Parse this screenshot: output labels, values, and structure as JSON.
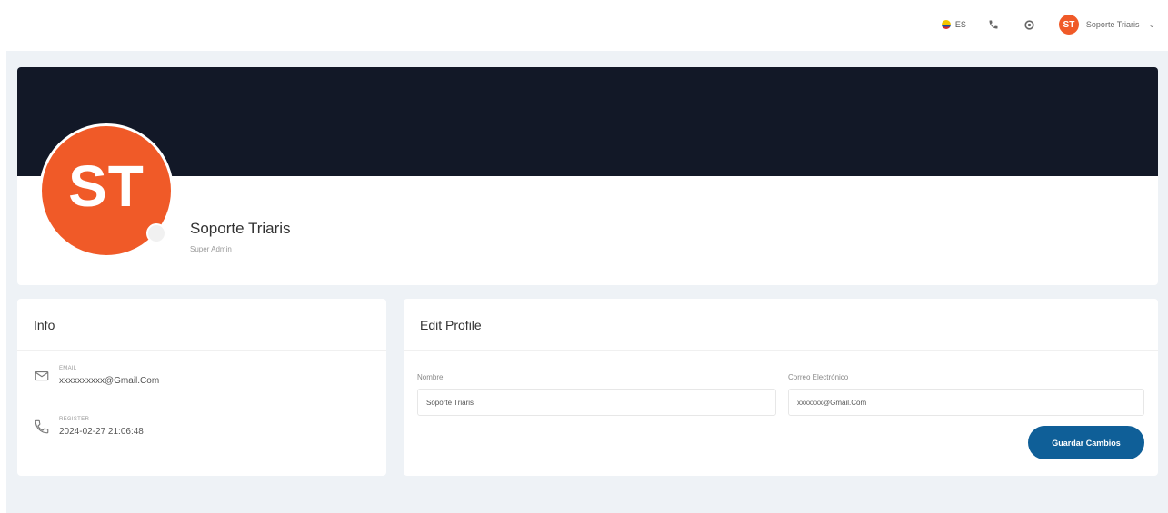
{
  "topbar": {
    "language": "ES",
    "user_initials": "ST",
    "user_name": "Soporte Triaris"
  },
  "profile": {
    "initials": "ST",
    "name": "Soporte Triaris",
    "role": "Super Admin"
  },
  "info": {
    "title": "Info",
    "email_label": "EMAIL",
    "email_value": "xxxxxxxxxx@Gmail.Com",
    "register_label": "REGISTER",
    "register_value": "2024-02-27 21:06:48"
  },
  "edit_profile": {
    "title": "Edit Profile",
    "name_label": "Nombre",
    "name_value": "Soporte Triaris",
    "email_label": "Correo Electrónico",
    "email_value": "xxxxxxx@Gmail.Com",
    "save_label": "Guardar Cambios"
  },
  "colors": {
    "banner": "#121827",
    "avatar": "#f05a28",
    "primary_button": "#0f5f98",
    "page_background": "#eef2f6"
  },
  "icons": [
    "flag-icon",
    "phone-icon",
    "settings-icon",
    "chevron-down-icon",
    "mail-icon",
    "phone-register-icon"
  ]
}
